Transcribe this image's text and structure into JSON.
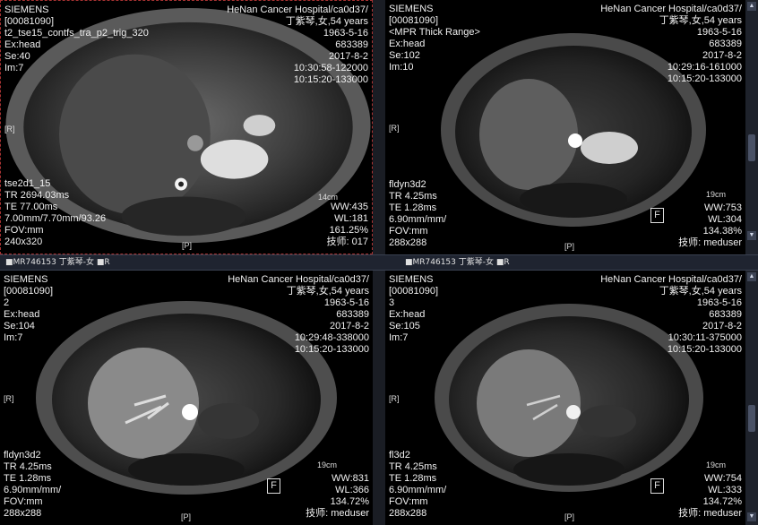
{
  "viewports": [
    {
      "tl": [
        "SIEMENS",
        "[00081090]",
        "t2_tse15_contfs_tra_p2_trig_320",
        "Ex:head",
        "Se:40",
        "Im:7"
      ],
      "tr": [
        "HeNan Cancer Hospital/ca0d37/",
        "丁紫琴,女,54 years",
        "1963-5-16",
        "683389",
        "2017-8-2",
        "10:30:58-122000",
        "10:15:20-133000"
      ],
      "bl": [
        "tse2d1_15",
        "TR 2694.03ms",
        "TE 77.00ms",
        "7.00mm/7.70mm/93.26",
        "FOV:mm",
        "240x320"
      ],
      "br": [
        "WW:435",
        "WL:181",
        "161.25%",
        "技师:   017"
      ],
      "scale": "14cm",
      "left_marker": "[R]",
      "bottom_marker": "[P]",
      "f_marker": ""
    },
    {
      "tl": [
        "SIEMENS",
        "[00081090]",
        "<MPR Thick Range>",
        "Ex:head",
        "Se:102",
        "Im:10"
      ],
      "tr": [
        "HeNan Cancer Hospital/ca0d37/",
        "丁紫琴,女,54 years",
        "1963-5-16",
        "683389",
        "2017-8-2",
        "10:29:16-161000",
        "10:15:20-133000"
      ],
      "bl": [
        "fldyn3d2",
        "TR 4.25ms",
        "TE 1.28ms",
        "6.90mm/mm/",
        "FOV:mm",
        "288x288"
      ],
      "br": [
        "WW:753",
        "WL:304",
        "134.38%",
        "技师:   meduser"
      ],
      "scale": "19cm",
      "left_marker": "[R]",
      "bottom_marker": "[P]",
      "f_marker": "F"
    },
    {
      "tl": [
        "SIEMENS",
        "[00081090]",
        "2",
        "Ex:head",
        "Se:104",
        "Im:7"
      ],
      "tr": [
        "HeNan Cancer Hospital/ca0d37/",
        "丁紫琴,女,54 years",
        "1963-5-16",
        "683389",
        "2017-8-2",
        "10:29:48-338000",
        "10:15:20-133000"
      ],
      "bl": [
        "fldyn3d2",
        "TR 4.25ms",
        "TE 1.28ms",
        "6.90mm/mm/",
        "FOV:mm",
        "288x288"
      ],
      "br": [
        "WW:831",
        "WL:366",
        "134.72%",
        "技师:   meduser"
      ],
      "scale": "19cm",
      "left_marker": "[R]",
      "bottom_marker": "[P]",
      "f_marker": "F"
    },
    {
      "tl": [
        "SIEMENS",
        "[00081090]",
        "3",
        "Ex:head",
        "Se:105",
        "Im:7"
      ],
      "tr": [
        "HeNan Cancer Hospital/ca0d37/",
        "丁紫琴,女,54 years",
        "1963-5-16",
        "683389",
        "2017-8-2",
        "10:30:11-375000",
        "10:15:20-133000"
      ],
      "bl": [
        "fl3d2",
        "TR 4.25ms",
        "TE 1.28ms",
        "6.90mm/mm/",
        "FOV:mm",
        "288x288"
      ],
      "br": [
        "WW:754",
        "WL:333",
        "134.72%",
        "技师:   meduser"
      ],
      "scale": "19cm",
      "left_marker": "[R]",
      "bottom_marker": "[P]",
      "f_marker": "F"
    }
  ],
  "separator": {
    "left_title": "■MR746153 丁紫琴-女 ■R",
    "right_title": "■MR746153 丁紫琴-女 ■R"
  }
}
